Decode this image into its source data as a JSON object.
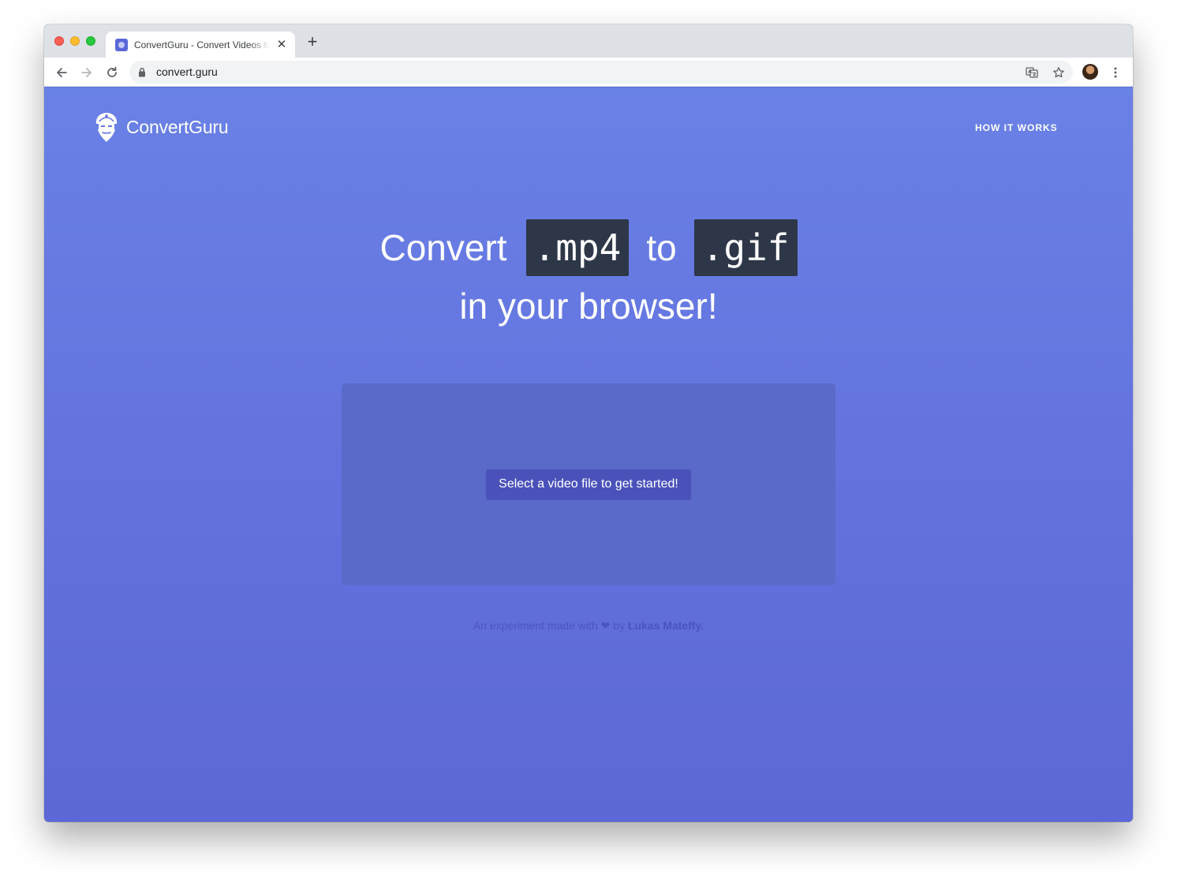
{
  "browser": {
    "tab_title": "ConvertGuru - Convert Videos to GIF",
    "tab_close_icon": "close-icon",
    "new_tab_label": "+",
    "url": "convert.guru"
  },
  "site": {
    "brand_name": "ConvertGuru",
    "nav_link": "HOW IT WORKS"
  },
  "hero": {
    "word_convert": "Convert",
    "from_format": ".mp4",
    "word_to": "to",
    "to_format": ".gif",
    "line2": "in your browser!"
  },
  "dropzone": {
    "button_label": "Select a video file to get started!"
  },
  "footer": {
    "prefix": "An experiment made with",
    "heart": "❤",
    "by": "by",
    "author": "Lukas Mateffy."
  },
  "colors": {
    "page_background": "#6373de",
    "dropzone": "#5a6ac9",
    "button": "#4a52ba",
    "code_chip": "#2d3748"
  }
}
